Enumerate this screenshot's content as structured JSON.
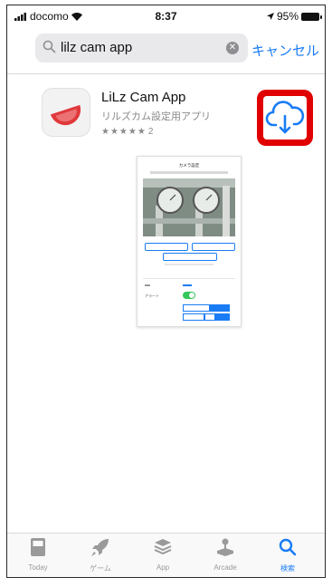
{
  "status_bar": {
    "carrier": "docomo",
    "time": "8:37",
    "battery": "95%"
  },
  "search": {
    "query": "lilz cam app",
    "cancel_label": "キャンセル"
  },
  "app": {
    "title": "LiLz Cam App",
    "subtitle": "リルズカム設定用アプリ",
    "stars": "★★★★★",
    "rating_count": "2",
    "accent_color": "#1a7cf5",
    "highlight_color": "#e00000"
  },
  "screenshot_preview": {
    "header": "カメラ設定",
    "toggle_label": "アラート"
  },
  "tabs": [
    {
      "label": "Today",
      "icon": "today-icon",
      "active": false
    },
    {
      "label": "ゲーム",
      "icon": "rocket-icon",
      "active": false
    },
    {
      "label": "App",
      "icon": "layers-icon",
      "active": false
    },
    {
      "label": "Arcade",
      "icon": "joystick-icon",
      "active": false
    },
    {
      "label": "検索",
      "icon": "search-icon",
      "active": true
    }
  ]
}
